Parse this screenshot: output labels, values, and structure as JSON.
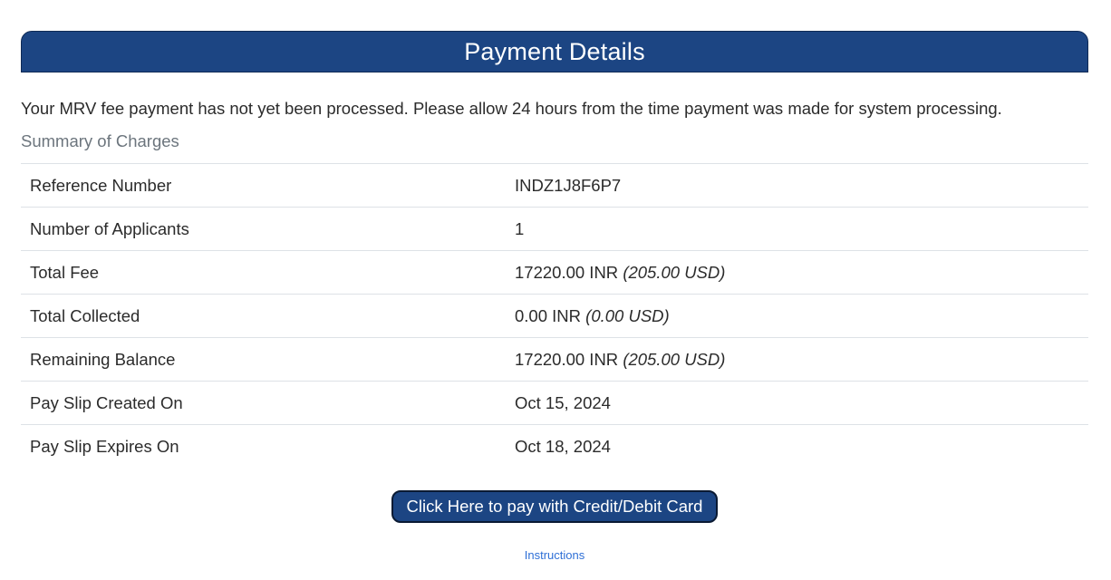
{
  "header": {
    "title": "Payment Details"
  },
  "notice": "Your MRV fee payment has not yet been processed. Please allow 24 hours from the time payment was made for system processing.",
  "summary": {
    "label": "Summary of Charges",
    "rows": [
      {
        "label": "Reference Number",
        "value": "INDZ1J8F6P7",
        "usd": ""
      },
      {
        "label": "Number of Applicants",
        "value": "1",
        "usd": ""
      },
      {
        "label": "Total Fee",
        "value": "17220.00 INR ",
        "usd": "(205.00 USD)"
      },
      {
        "label": "Total Collected",
        "value": "0.00 INR ",
        "usd": "(0.00 USD)"
      },
      {
        "label": "Remaining Balance",
        "value": "17220.00 INR ",
        "usd": "(205.00 USD)"
      },
      {
        "label": "Pay Slip Created On",
        "value": "Oct 15, 2024",
        "usd": ""
      },
      {
        "label": "Pay Slip Expires On",
        "value": "Oct 18, 2024",
        "usd": ""
      }
    ]
  },
  "actions": {
    "pay_button_label": "Click Here to pay with Credit/Debit Card",
    "instructions_link": "Instructions"
  },
  "colors": {
    "header_background": "#1c4583",
    "link": "#2e6fd6"
  }
}
